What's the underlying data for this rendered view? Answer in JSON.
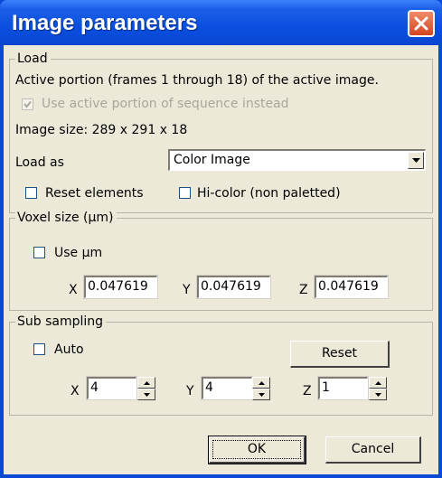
{
  "window": {
    "title": "Image parameters"
  },
  "load": {
    "legend": "Load",
    "info": "Active portion (frames 1 through 18) of the active image.",
    "use_active_label": "Use active portion of sequence instead",
    "use_active_checked": true,
    "image_size": "Image size: 289 x 291 x 18",
    "load_as_label": "Load as",
    "load_as_value": "Color Image",
    "reset_elements_label": "Reset elements",
    "reset_elements_checked": false,
    "hicolor_label": "Hi-color (non paletted)",
    "hicolor_checked": false
  },
  "voxel": {
    "legend": "Voxel size (µm)",
    "use_um_label": "Use µm",
    "use_um_checked": false,
    "x_label": "X",
    "x_value": "0.047619",
    "y_label": "Y",
    "y_value": "0.047619",
    "z_label": "Z",
    "z_value": "0.047619"
  },
  "subsampling": {
    "legend": "Sub sampling",
    "auto_label": "Auto",
    "auto_checked": false,
    "reset_label": "Reset",
    "x_label": "X",
    "x_value": "4",
    "y_label": "Y",
    "y_value": "4",
    "z_label": "Z",
    "z_value": "1"
  },
  "buttons": {
    "ok": "OK",
    "cancel": "Cancel"
  },
  "colors": {
    "titlebar": "#0a4fe0",
    "face": "#ece9d8",
    "close": "#d4461e"
  }
}
